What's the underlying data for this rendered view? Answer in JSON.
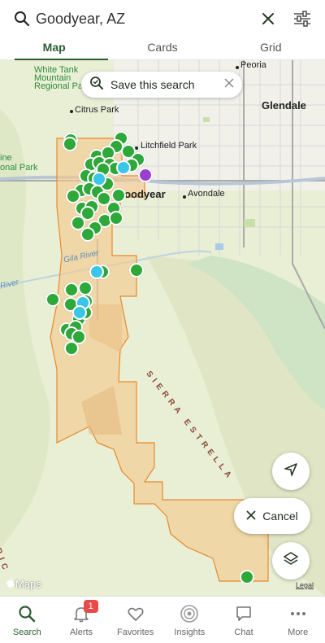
{
  "search": {
    "query": "Goodyear, AZ"
  },
  "tabs": [
    {
      "label": "Map",
      "active": true
    },
    {
      "label": "Cards",
      "active": false
    },
    {
      "label": "Grid",
      "active": false
    }
  ],
  "map": {
    "save_search_label": "Save this search",
    "cancel_label": "Cancel",
    "attribution": "Maps",
    "legal_label": "Legal",
    "labels": {
      "white_tank": "White Tank",
      "mountain": "Mountain",
      "regional_park": "Regional Park",
      "ine": "ine",
      "onal_park": "onal Park",
      "peoria": "Peoria",
      "glendale": "Glendale",
      "citrus_park": "Citrus Park",
      "litchfield_park": "Litchfield Park",
      "goodyear": "Goodyear",
      "avondale": "Avondale",
      "gila_river": "Gila River",
      "river": "River",
      "sierra_estrella": "SIERRA ESTRELLA",
      "ric": "RIC"
    },
    "colors": {
      "listing": "#2fa83a",
      "highlight": "#3bc6e8",
      "selected": "#9b3fd0",
      "boundary": "#e8882a"
    }
  },
  "tabbar": {
    "items": [
      {
        "label": "Search",
        "icon": "search-icon",
        "active": true
      },
      {
        "label": "Alerts",
        "icon": "bell-icon",
        "badge": "1"
      },
      {
        "label": "Favorites",
        "icon": "heart-icon"
      },
      {
        "label": "Insights",
        "icon": "insights-icon"
      },
      {
        "label": "Chat",
        "icon": "chat-icon"
      },
      {
        "label": "More",
        "icon": "more-icon"
      }
    ]
  }
}
